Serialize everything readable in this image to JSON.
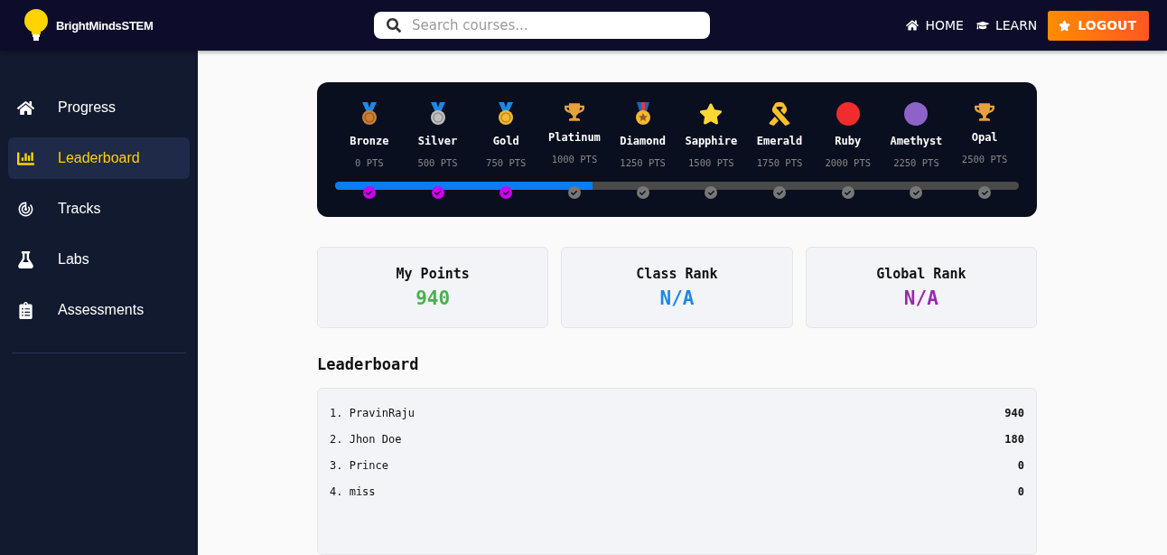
{
  "header": {
    "brand": "BrightMindsSTEM",
    "search": {
      "placeholder": "Search courses..."
    },
    "nav": [
      {
        "label": "HOME",
        "kind": "home"
      },
      {
        "label": "LEARN",
        "kind": "learn"
      }
    ],
    "logout": "LOGOUT"
  },
  "sidebar": {
    "items": [
      {
        "label": "Progress",
        "kind": "home",
        "selected": false
      },
      {
        "label": "Leaderboard",
        "kind": "chart",
        "selected": true
      },
      {
        "label": "Tracks",
        "kind": "target",
        "selected": false
      },
      {
        "label": "Labs",
        "kind": "flask",
        "selected": false
      },
      {
        "label": "Assessments",
        "kind": "clipboard",
        "selected": false
      }
    ]
  },
  "badges": {
    "level": 0.377,
    "checks": [
      {
        "color": "#cc00ee"
      },
      {
        "color": "#cc00ee"
      },
      {
        "color": "#cc00ee"
      },
      {
        "color": "#777777"
      },
      {
        "color": "#777777"
      },
      {
        "color": "#777777"
      },
      {
        "color": "#777777"
      },
      {
        "color": "#777777"
      },
      {
        "color": "#777777"
      },
      {
        "color": "#777777"
      }
    ],
    "items": [
      {
        "name": "Bronze",
        "points": "0 PTS",
        "kind": "medal",
        "color": "#cd7f32"
      },
      {
        "name": "Silver",
        "points": "500 PTS",
        "kind": "medal",
        "color": "#c0c0c0"
      },
      {
        "name": "Gold",
        "points": "750 PTS",
        "kind": "medal",
        "color": "#f5b82e"
      },
      {
        "name": "Platinum",
        "points": "1000 PTS",
        "kind": "trophy",
        "color": "#e6a23c"
      },
      {
        "name": "Diamond",
        "points": "1250 PTS",
        "kind": "star-medal",
        "color": "#f5b82e"
      },
      {
        "name": "Sapphire",
        "points": "1500 PTS",
        "kind": "star",
        "color": "#fdd835"
      },
      {
        "name": "Emerald",
        "points": "1750 PTS",
        "kind": "ribbon",
        "color": "#fbc02d"
      },
      {
        "name": "Ruby",
        "points": "2000 PTS",
        "kind": "circle",
        "color": "#f02c2c"
      },
      {
        "name": "Amethyst",
        "points": "2250 PTS",
        "kind": "circle",
        "color": "#8e63c7"
      },
      {
        "name": "Opal",
        "points": "2500 PTS",
        "kind": "trophy",
        "color": "#e6a23c"
      }
    ]
  },
  "stats": [
    {
      "label": "My Points",
      "value": "940",
      "color": "#4caf50"
    },
    {
      "label": "Class Rank",
      "value": "N/A",
      "color": "#1e88e5"
    },
    {
      "label": "Global Rank",
      "value": "N/A",
      "color": "#9c27b0"
    }
  ],
  "leaderboard": {
    "title": "Leaderboard",
    "rows": [
      {
        "name": "1. PravinRaju",
        "score": "940"
      },
      {
        "name": "2. Jhon Doe",
        "score": "180"
      },
      {
        "name": "3. Prince",
        "score": "0"
      },
      {
        "name": "4. miss",
        "score": "0"
      }
    ]
  }
}
